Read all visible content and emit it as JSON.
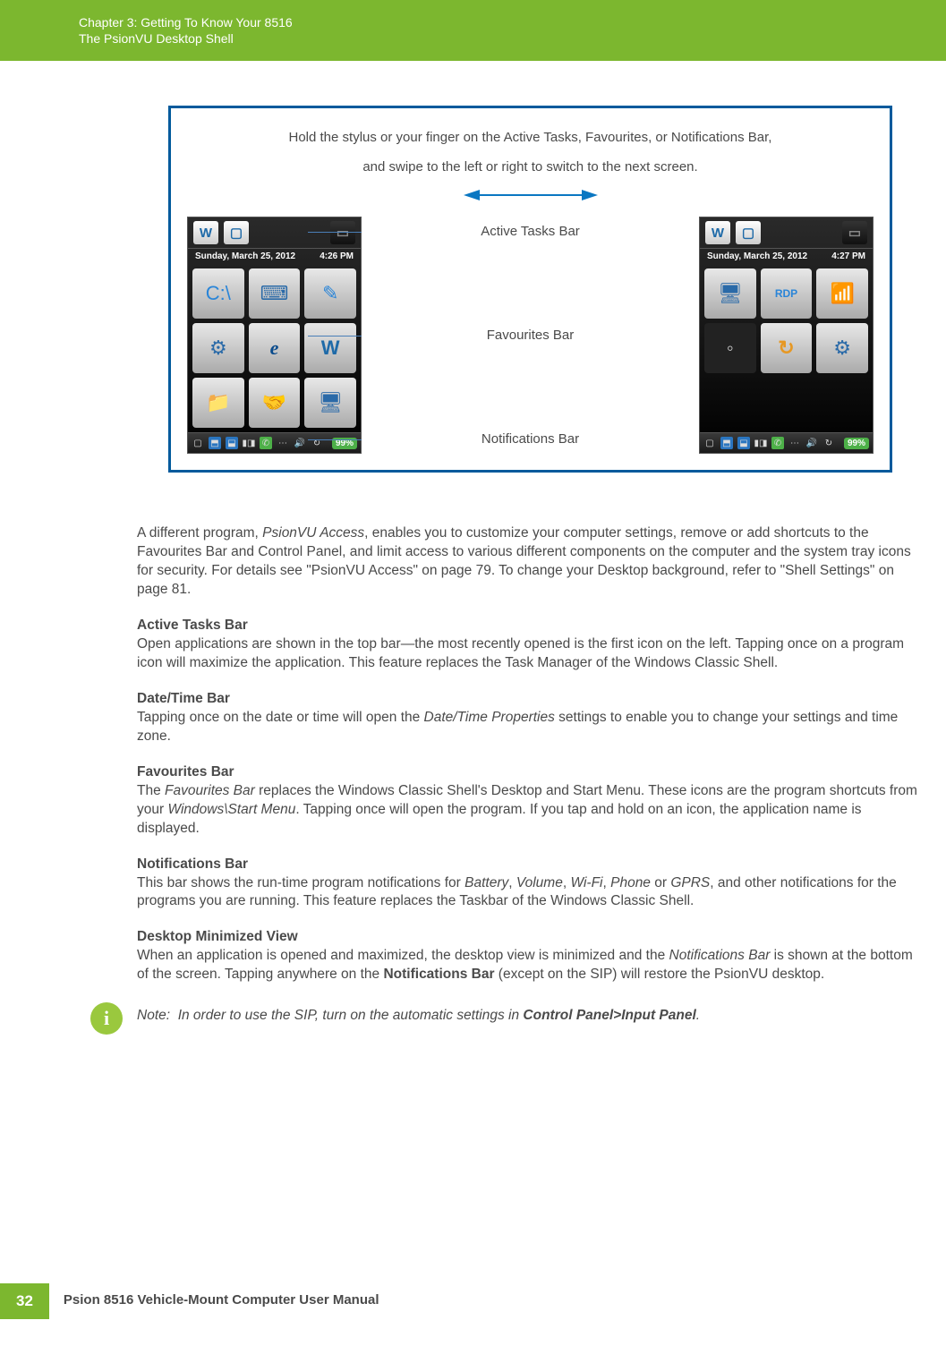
{
  "header": {
    "chapter": "Chapter 3:",
    "chapterTitle": "Getting To Know Your 8516",
    "section": "The PsionVU Desktop Shell"
  },
  "figure": {
    "caption1": "Hold the stylus or your finger on the Active Tasks, Favourites, or Notifications Bar,",
    "caption2": "and swipe to the left or right to switch to the next screen.",
    "labels": {
      "active": "Active Tasks Bar",
      "fav": "Favourites Bar",
      "notif": "Notifications Bar"
    },
    "phoneLeft": {
      "date": "Sunday, March 25, 2012",
      "time": "4:26 PM",
      "battery": "99%"
    },
    "phoneRight": {
      "date": "Sunday, March 25, 2012",
      "time": "4:27 PM",
      "battery": "99%"
    }
  },
  "paragraphs": {
    "intro": {
      "p1a": "A different program, ",
      "p1b": "PsionVU Access",
      "p1c": ", enables you to customize your computer settings, remove or add shortcuts to the Favourites Bar and Control Panel, and limit access to various different components on the computer and the system tray icons for security. For details see \"PsionVU Access\" on page 79. To change your Desktop background, refer to \"Shell Settings\" on page 81."
    }
  },
  "sections": {
    "active": {
      "head": "Active Tasks Bar",
      "body": "Open applications are shown in the top bar—the most recently opened is the first icon on the left. Tapping once on a program icon will maximize the application. This feature replaces the Task Manager of the Windows Classic Shell."
    },
    "datetime": {
      "head": "Date/Time Bar",
      "b1": "Tapping once on the date or time will open the ",
      "b2": "Date/Time Properties",
      "b3": " settings to enable you to change your settings and time zone."
    },
    "fav": {
      "head": "Favourites Bar",
      "b1": "The ",
      "b2": "Favourites Bar",
      "b3": " replaces the Windows Classic Shell's Desktop and Start Menu. These icons are the program shortcuts from your ",
      "b4": "Windows\\Start Menu",
      "b5": ". Tapping once will open the program. If you tap and hold on an icon, the application name is displayed."
    },
    "notif": {
      "head": "Notifications Bar",
      "b1": "This bar shows the run-time program notifications for ",
      "b2": "Battery",
      "b3": ", ",
      "b4": "Volume",
      "b5": ", ",
      "b6": "Wi-Fi",
      "b7": ", ",
      "b8": "Phone",
      "b9": " or ",
      "b10": "GPRS",
      "b11": ", and other notifications for the programs you are running. This feature replaces the Taskbar of the Windows Classic Shell."
    },
    "desktop": {
      "head": "Desktop Minimized View",
      "b1": "When an application is opened and maximized, the desktop view is minimized and the ",
      "b2": "Notifications Bar",
      "b3": " is shown at the bottom of the screen. Tapping anywhere on the ",
      "b4": "Notifications Bar",
      "b5": " (except on the SIP) will restore the PsionVU desktop."
    }
  },
  "note": {
    "label": "Note:",
    "t1": "In order to use the SIP, turn on the automatic settings in ",
    "t2": "Control Panel>Input Panel",
    "t3": "."
  },
  "footer": {
    "page": "32",
    "manual": "Psion 8516 Vehicle-Mount Computer User Manual"
  }
}
